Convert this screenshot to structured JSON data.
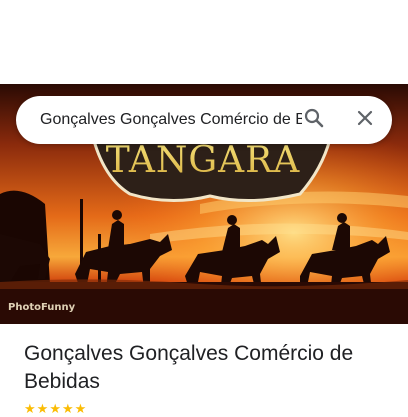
{
  "search": {
    "query": "Gonçalves Gonçalves Comércio de Bebidas"
  },
  "hero": {
    "sign_text": "TANGARA",
    "watermark": "PhotoFunny"
  },
  "place": {
    "name": "Gonçalves Gonçalves Comércio de Bebidas",
    "rating_stars": 5,
    "review_count": ""
  },
  "icons": {
    "search": "search-icon",
    "close": "close-icon"
  },
  "colors": {
    "star": "#fbbc04",
    "text": "#202124"
  }
}
